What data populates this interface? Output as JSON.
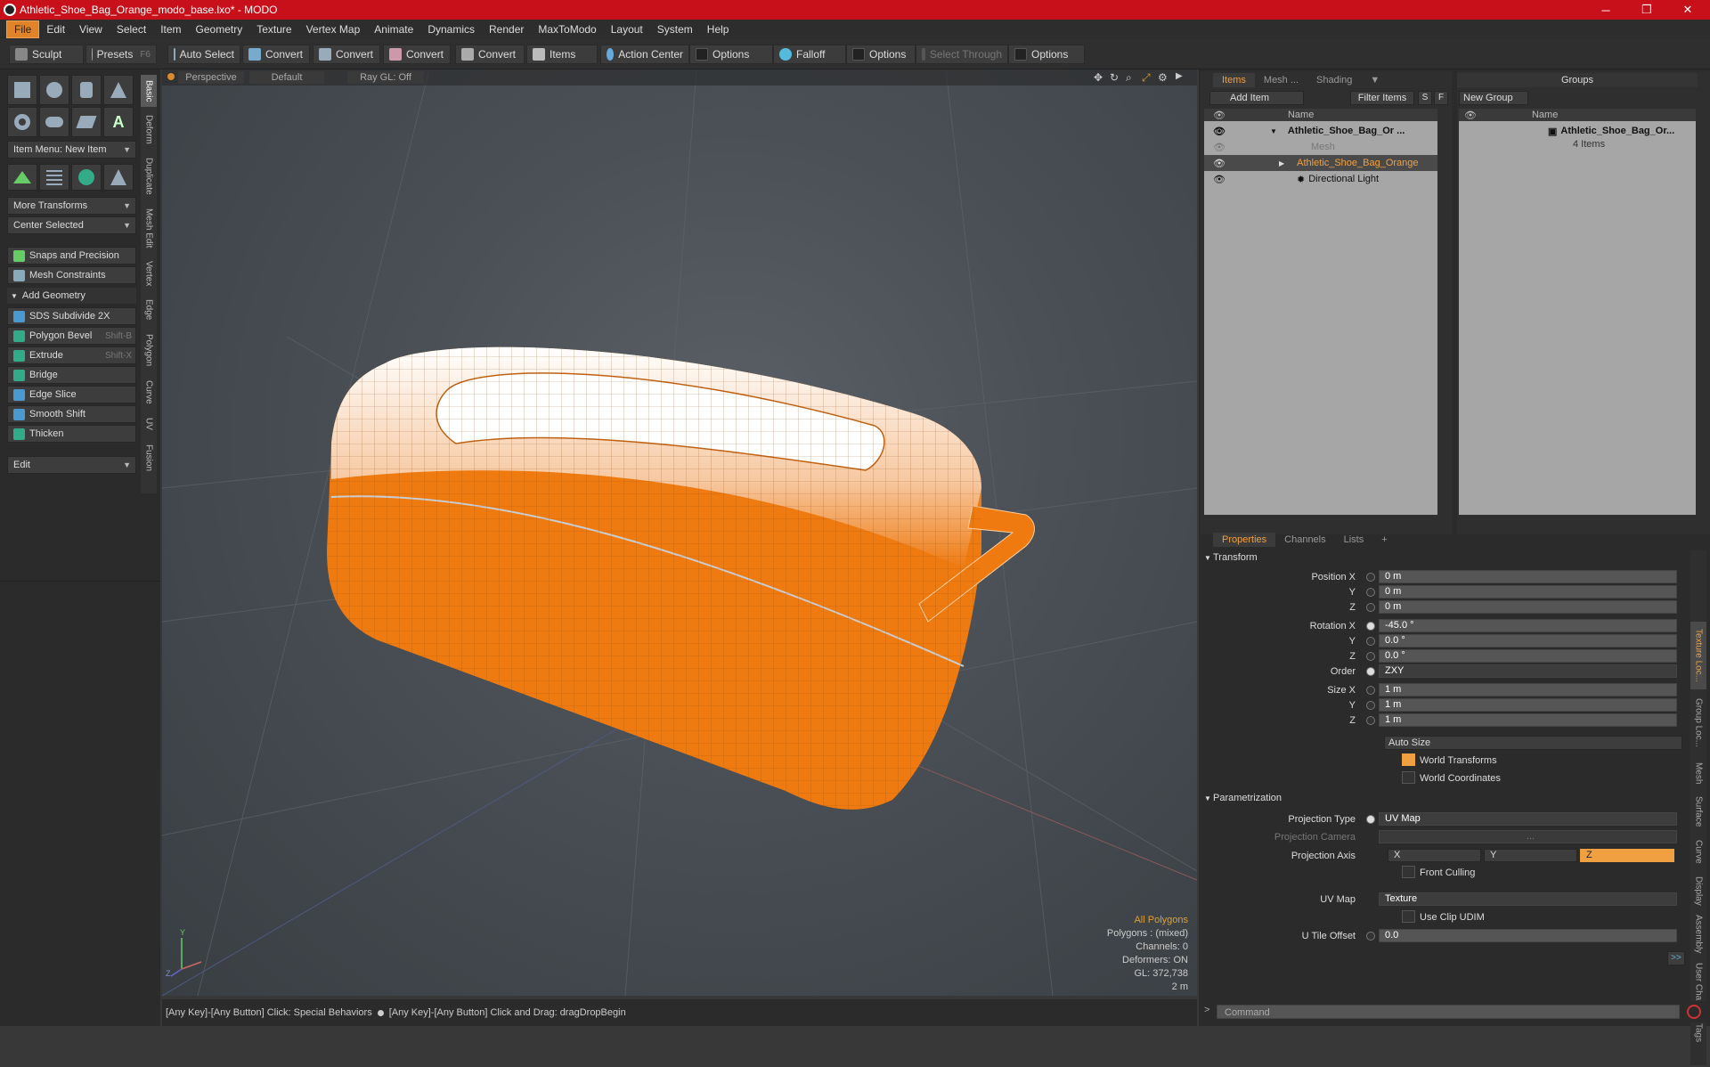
{
  "window": {
    "title": "Athletic_Shoe_Bag_Orange_modo_base.lxo* - MODO",
    "min_icon": "minimize-icon",
    "max_icon": "restore-icon",
    "close_icon": "close-icon"
  },
  "menu": [
    "File",
    "Edit",
    "View",
    "Select",
    "Item",
    "Geometry",
    "Texture",
    "Vertex Map",
    "Animate",
    "Dynamics",
    "Render",
    "MaxToModo",
    "Layout",
    "System",
    "Help"
  ],
  "toolbar": {
    "sculpt": "Sculpt",
    "presets": "Presets",
    "presets_key": "F6",
    "auto_select": "Auto Select",
    "convert1": "Convert",
    "convert2": "Convert",
    "convert3": "Convert",
    "convert4": "Convert",
    "items": "Items",
    "action_center": "Action Center",
    "options1": "Options",
    "falloff": "Falloff",
    "options2": "Options",
    "select_through": "Select Through",
    "options3": "Options"
  },
  "leftpanel": {
    "item_menu": "Item Menu: New Item",
    "more_transforms": "More Transforms",
    "center_selected": "Center Selected",
    "snaps": "Snaps and Precision",
    "mesh_constraints": "Mesh Constraints",
    "add_geometry": "Add Geometry",
    "tools": [
      {
        "label": "SDS Subdivide 2X",
        "key": ""
      },
      {
        "label": "Polygon Bevel",
        "key": "Shift-B"
      },
      {
        "label": "Extrude",
        "key": "Shift-X"
      },
      {
        "label": "Bridge",
        "key": ""
      },
      {
        "label": "Edge Slice",
        "key": ""
      },
      {
        "label": "Smooth Shift",
        "key": ""
      },
      {
        "label": "Thicken",
        "key": ""
      }
    ],
    "edit": "Edit",
    "vtabs": [
      "Basic",
      "Deform",
      "Duplicate",
      "Mesh Edit",
      "Vertex",
      "Edge",
      "Polygon",
      "Curve",
      "UV",
      "Fusion"
    ]
  },
  "viewport": {
    "view": "Perspective",
    "shading": "Default",
    "raygl": "Ray GL: Off",
    "stats": {
      "all": "All Polygons",
      "polygons": "Polygons : (mixed)",
      "channels": "Channels: 0",
      "deformers": "Deformers: ON",
      "gl": "GL: 372,738",
      "scale": "2 m"
    },
    "bag_color": "#ef7a10"
  },
  "status": {
    "left": "[Any Key]-[Any Button] Click: Special Behaviors",
    "right": "[Any Key]-[Any Button] Click and Drag: dragDropBegin"
  },
  "items_panel": {
    "tabs": [
      "Items",
      "Mesh ...",
      "Shading"
    ],
    "add_item": "Add Item",
    "filter_items": "Filter Items",
    "s": "S",
    "f": "F",
    "name_col": "Name",
    "rows": [
      "Athletic_Shoe_Bag_Or ...",
      "Mesh",
      "Athletic_Shoe_Bag_Orange",
      "Directional Light"
    ]
  },
  "groups_panel": {
    "title": "Groups",
    "new_group": "New Group",
    "name_col": "Name",
    "group_name": "Athletic_Shoe_Bag_Or...",
    "count": "4 Items"
  },
  "properties": {
    "tabs": [
      "Properties",
      "Channels",
      "Lists"
    ],
    "transform": "Transform",
    "rows": [
      {
        "label": "Position X",
        "value": "0 m"
      },
      {
        "label": "Y",
        "value": "0 m"
      },
      {
        "label": "Z",
        "value": "0 m"
      },
      {
        "label": "Rotation X",
        "value": "-45.0 °"
      },
      {
        "label": "Y",
        "value": "0.0 °"
      },
      {
        "label": "Z",
        "value": "0.0 °"
      },
      {
        "label": "Order",
        "value": "ZXY"
      },
      {
        "label": "Size X",
        "value": "1 m"
      },
      {
        "label": "Y",
        "value": "1 m"
      },
      {
        "label": "Z",
        "value": "1 m"
      }
    ],
    "auto_size": "Auto Size",
    "world_transforms": "World Transforms",
    "world_coordinates": "World Coordinates",
    "parametrization": "Parametrization",
    "projection_type_label": "Projection Type",
    "projection_type": "UV Map",
    "projection_camera_label": "Projection Camera",
    "projection_camera": "...",
    "projection_axis_label": "Projection Axis",
    "axis": [
      "X",
      "Y",
      "Z"
    ],
    "front_culling": "Front Culling",
    "uv_map_label": "UV Map",
    "uv_map": "Texture",
    "use_clip": "Use Clip UDIM",
    "u_tile_label": "U Tile Offset",
    "u_tile": "0.0",
    "more": ">>",
    "vtabs": [
      "Texture Loc...",
      "Group Loc...",
      "Mesh",
      "Surface",
      "Curve",
      "Display",
      "Assembly",
      "User Chan...",
      "Tags"
    ]
  },
  "command": {
    "placeholder": "Command"
  }
}
